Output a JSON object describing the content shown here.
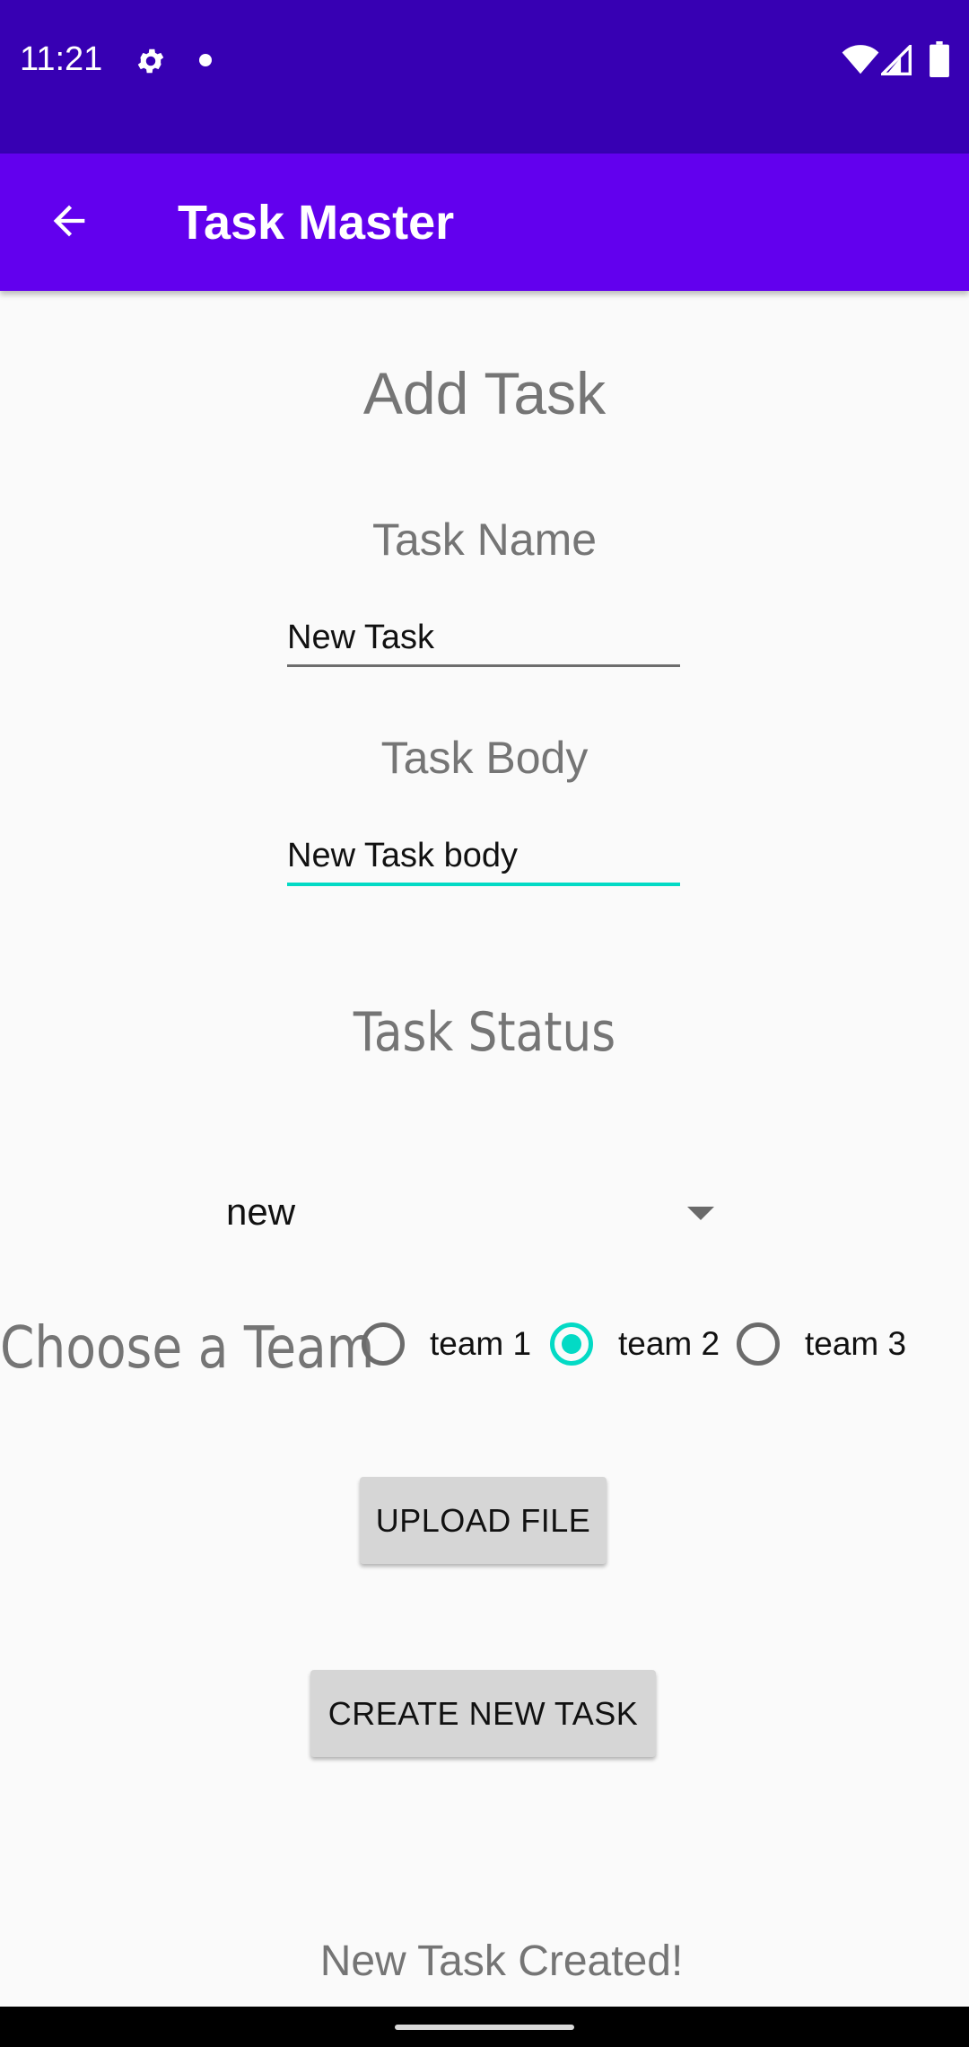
{
  "status_bar": {
    "time": "11:21",
    "icons": [
      "gear-icon",
      "notification-dot-icon",
      "wifi-icon",
      "signal-icon",
      "battery-icon"
    ],
    "background": "#3700b3"
  },
  "app_bar": {
    "title": "Task Master",
    "back_icon": "arrow-back-icon",
    "background": "#6200ee"
  },
  "form": {
    "heading": "Add Task",
    "task_name_label": "Task Name",
    "task_name_value": "New Task",
    "task_body_label": "Task Body",
    "task_body_value": "New Task body",
    "task_status_label": "Task Status",
    "status_selected": "new",
    "team_label": "Choose a Team",
    "teams": [
      {
        "label": "team 1",
        "checked": false
      },
      {
        "label": "team 2",
        "checked": true
      },
      {
        "label": "team 3",
        "checked": false
      }
    ],
    "upload_button": "UPLOAD FILE",
    "create_button": "CREATE NEW TASK",
    "result_message": "New Task Created!"
  },
  "colors": {
    "accent": "#03dac5",
    "muted_text": "#757575"
  }
}
